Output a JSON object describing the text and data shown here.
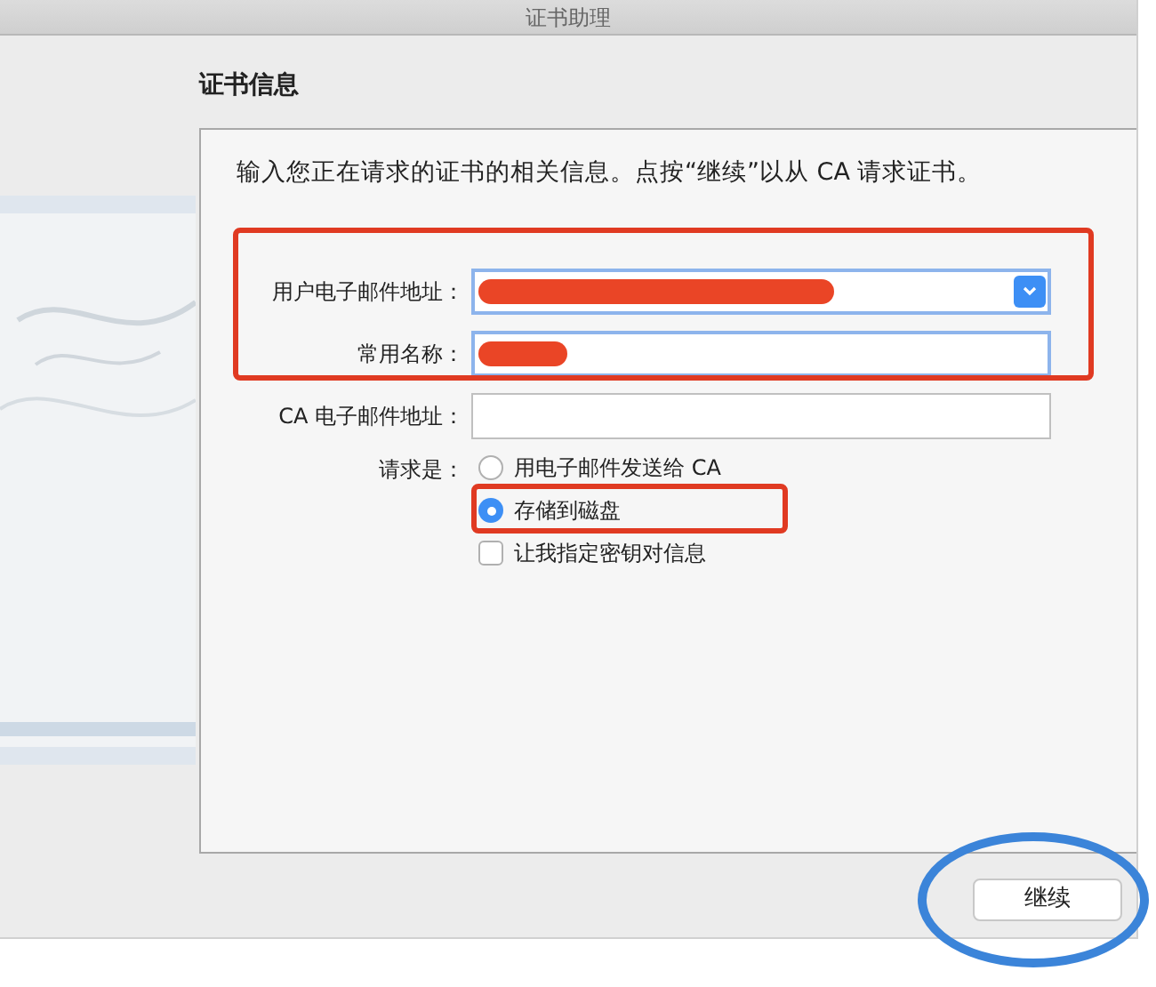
{
  "window": {
    "title": "证书助理"
  },
  "section_title": "证书信息",
  "intro": "输入您正在请求的证书的相关信息。点按“继续”以从 CA 请求证书。",
  "fields": [
    {
      "label": "用户电子邮件地址：",
      "kind": "combo",
      "redacted": true,
      "focused": true
    },
    {
      "label": "常用名称：",
      "kind": "text",
      "redacted": true,
      "focused": true
    },
    {
      "label": "CA 电子邮件地址：",
      "kind": "text",
      "focused": false
    }
  ],
  "request": {
    "label": "请求是：",
    "options": [
      {
        "kind": "radio",
        "label": "用电子邮件发送给 CA",
        "selected": false
      },
      {
        "kind": "radio",
        "label": "存储到磁盘",
        "selected": true
      },
      {
        "kind": "checkbox",
        "label": "让我指定密钥对信息",
        "checked": false
      }
    ]
  },
  "buttons": [
    "继续"
  ]
}
